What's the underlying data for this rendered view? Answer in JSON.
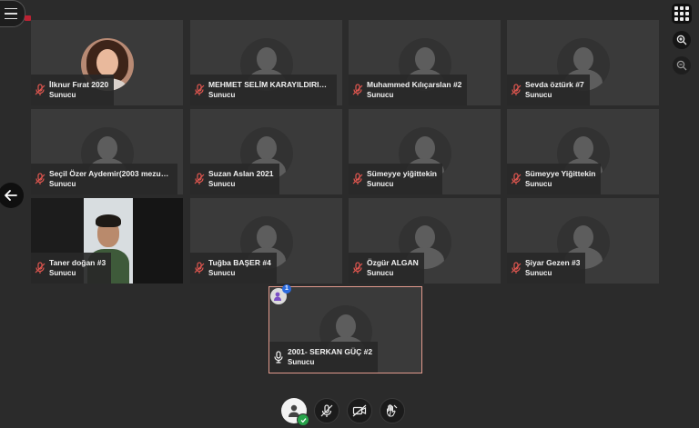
{
  "participants": [
    {
      "name": "İlknur Fırat 2020",
      "role": "Sunucu",
      "avatar": "photo"
    },
    {
      "name": "MEHMET SELİM KARAYILDIRIM #2",
      "role": "Sunucu",
      "avatar": "placeholder"
    },
    {
      "name": "Muhammed Kılıçarslan #2",
      "role": "Sunucu",
      "avatar": "placeholder"
    },
    {
      "name": "Sevda öztürk #7",
      "role": "Sunucu",
      "avatar": "placeholder"
    },
    {
      "name": "Seçil Özer Aydemir(2003 mezunu...",
      "role": "Sunucu",
      "avatar": "placeholder"
    },
    {
      "name": "Suzan Aslan 2021",
      "role": "Sunucu",
      "avatar": "placeholder"
    },
    {
      "name": "Sümeyye yiğittekin",
      "role": "Sunucu",
      "avatar": "placeholder"
    },
    {
      "name": "Sümeyye Yiğittekin",
      "role": "Sunucu",
      "avatar": "placeholder"
    },
    {
      "name": "Taner doğan #3",
      "role": "Sunucu",
      "avatar": "camera"
    },
    {
      "name": "Tuğba BAŞER #4",
      "role": "Sunucu",
      "avatar": "placeholder"
    },
    {
      "name": "Özgür ALGAN",
      "role": "Sunucu",
      "avatar": "placeholder"
    },
    {
      "name": "Şiyar Gezen #3",
      "role": "Sunucu",
      "avatar": "placeholder"
    }
  ],
  "active_speaker": {
    "name": "2001- SERKAN GÜÇ #2",
    "role": "Sunucu",
    "badge_count": "1"
  },
  "icons": {
    "menu": "hamburger-icon",
    "back": "arrow-left-icon",
    "grid": "grid-icon",
    "zoom_in": "zoom-in-icon",
    "zoom_out": "zoom-out-icon",
    "muted": "mic-off-icon",
    "mic": "mic-icon",
    "user": "user-icon",
    "camera_off": "camera-off-icon",
    "raise_hand": "hand-icon"
  },
  "colors": {
    "background": "#2b2b2b",
    "tile": "#3a3a3a",
    "muted_icon": "#e0564f",
    "speaker_border": "#e29a8d",
    "badge": "#2a6be0",
    "status_ok": "#27a34a"
  }
}
